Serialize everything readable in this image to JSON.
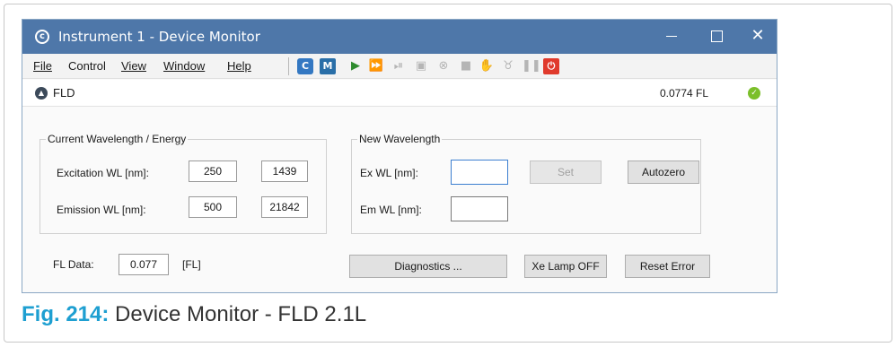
{
  "window": {
    "title": "Instrument 1 - Device Monitor",
    "app_icon": "logo-icon"
  },
  "menu": {
    "items": [
      {
        "label": "File"
      },
      {
        "label": "Control"
      },
      {
        "label": "View"
      },
      {
        "label": "Window"
      },
      {
        "label": "Help"
      }
    ]
  },
  "toolbar": {
    "icons": [
      "connect-icon",
      "manual-icon",
      "play-icon",
      "fast-forward-icon",
      "step-icon",
      "snapshot-icon",
      "cancel-icon",
      "stop-icon",
      "hand-icon",
      "lamp-icon",
      "pause-icon",
      "power-off-icon"
    ]
  },
  "panel": {
    "title": "FLD",
    "reading": "0.0774 FL",
    "status_color": "#7bbf2a"
  },
  "current": {
    "group_title": "Current Wavelength / Energy",
    "excitation_label": "Excitation WL [nm]:",
    "excitation_value": "250",
    "excitation_energy": "1439",
    "emission_label": "Emission WL [nm]:",
    "emission_value": "500",
    "emission_energy": "21842"
  },
  "new_wl": {
    "group_title": "New Wavelength",
    "ex_label": "Ex WL [nm]:",
    "ex_value": "",
    "em_label": "Em WL [nm]:",
    "em_value": "",
    "set_label": "Set",
    "autozero_label": "Autozero"
  },
  "fl_data": {
    "label": "FL Data:",
    "value": "0.077",
    "unit": "[FL]"
  },
  "buttons": {
    "diagnostics": "Diagnostics ...",
    "xe_lamp": "Xe Lamp OFF",
    "reset_error": "Reset Error"
  },
  "caption": {
    "fig": "Fig. 214:",
    "text": "Device Monitor - FLD 2.1L"
  },
  "colors": {
    "titlebar": "#4e77a9",
    "caption_accent": "#1e9fd1"
  }
}
